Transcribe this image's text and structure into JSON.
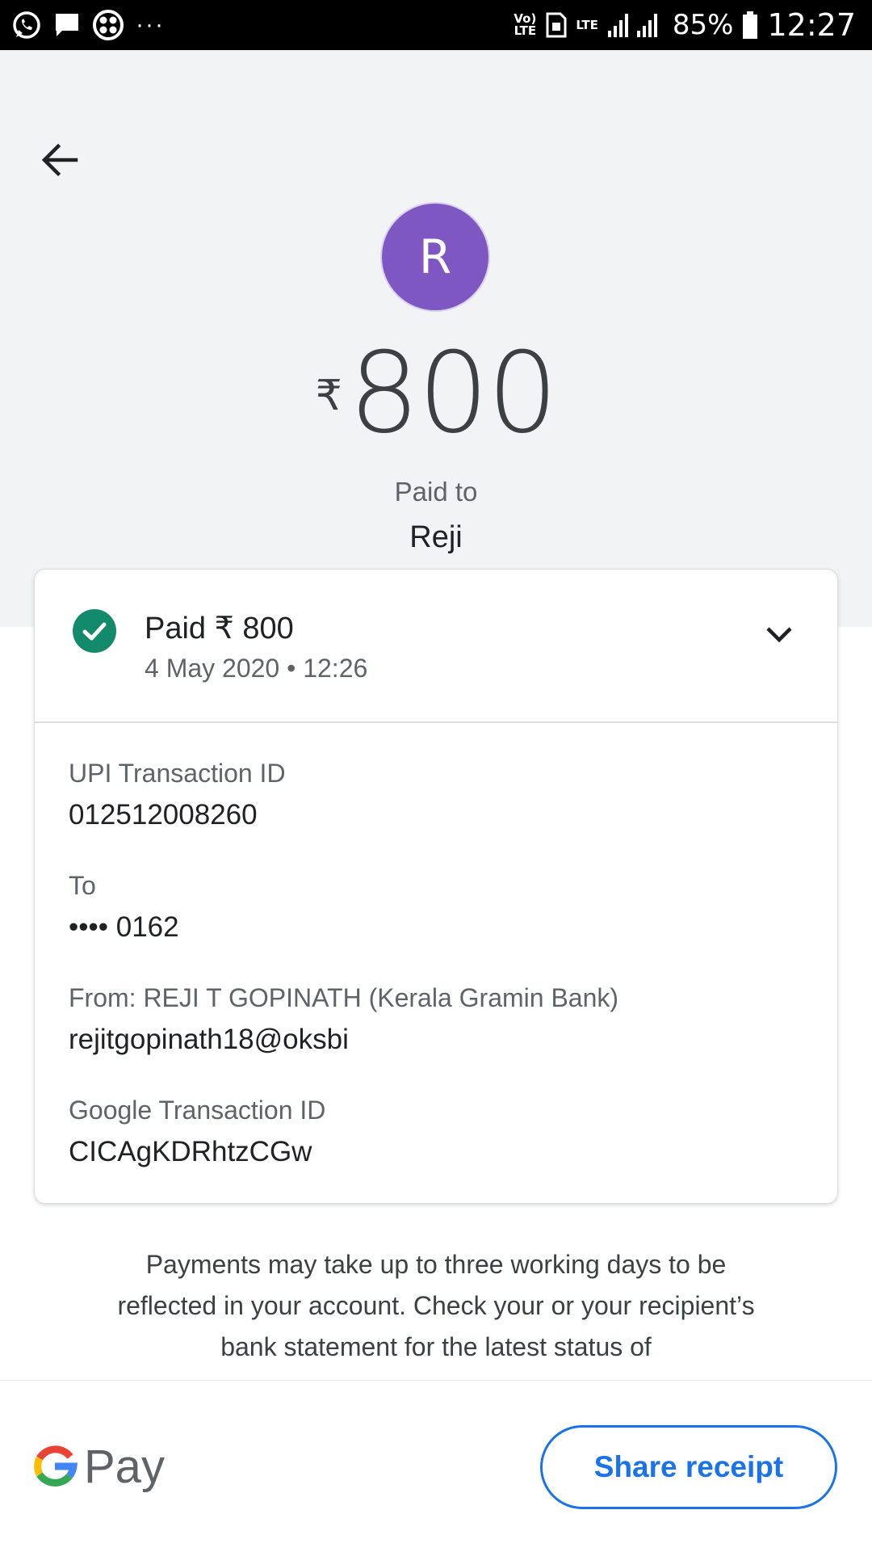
{
  "status_bar": {
    "icons_left": [
      "whatsapp-icon",
      "message-icon",
      "app-grid-icon"
    ],
    "more_dots": "···",
    "volte_label": "Vo) LTE",
    "lte_label": "LTE",
    "battery_percent": "85%",
    "time": "12:27"
  },
  "header": {
    "back_icon": "arrow-back-icon",
    "avatar_initial": "R",
    "avatar_color": "#7e57c2",
    "currency_symbol": "₹",
    "amount": "800",
    "paid_to_label": "Paid to",
    "payee_name": "Reji"
  },
  "transaction": {
    "status": "Paid ₹ 800",
    "datetime": "4 May 2020 • 12:26",
    "status_color": "#188038",
    "details": [
      {
        "label": "UPI Transaction ID",
        "value": "012512008260"
      },
      {
        "label": "To",
        "value": "•••• 0162"
      },
      {
        "label": "From: REJI T GOPINATH (Kerala Gramin Bank)",
        "value": "rejitgopinath18@oksbi"
      },
      {
        "label": "Google Transaction ID",
        "value": "CICAgKDRhtzCGw"
      }
    ]
  },
  "disclaimer": "Payments may take up to three working days to be reflected in your account. Check your or your recipient’s bank statement for the latest status of",
  "footer": {
    "logo_text": "Pay",
    "share_label": "Share receipt",
    "accent_color": "#1a73e8"
  }
}
